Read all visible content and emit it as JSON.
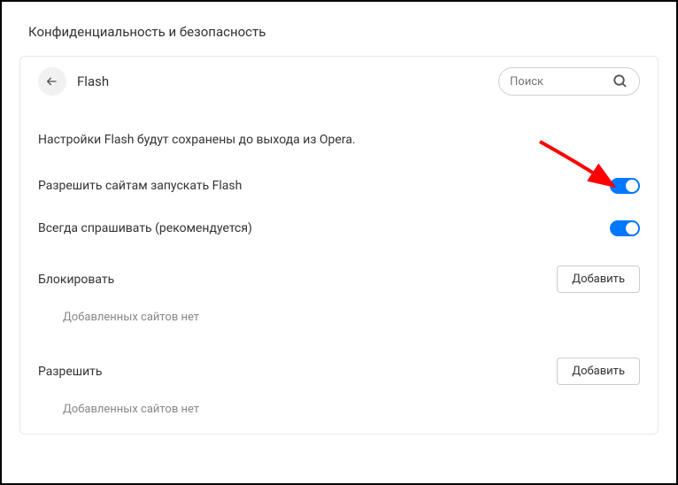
{
  "header": {
    "title": "Конфиденциальность и безопасность"
  },
  "panel": {
    "title": "Flash"
  },
  "search": {
    "placeholder": "Поиск"
  },
  "info": {
    "text": "Настройки Flash будут сохранены до выхода из Opera."
  },
  "settings": {
    "allow_flash": "Разрешить сайтам запускать Flash",
    "always_ask": "Всегда спрашивать (рекомендуется)"
  },
  "sections": {
    "block": {
      "title": "Блокировать",
      "add_button": "Добавить",
      "empty": "Добавленных сайтов нет"
    },
    "allow": {
      "title": "Разрешить",
      "add_button": "Добавить",
      "empty": "Добавленных сайтов нет"
    }
  }
}
